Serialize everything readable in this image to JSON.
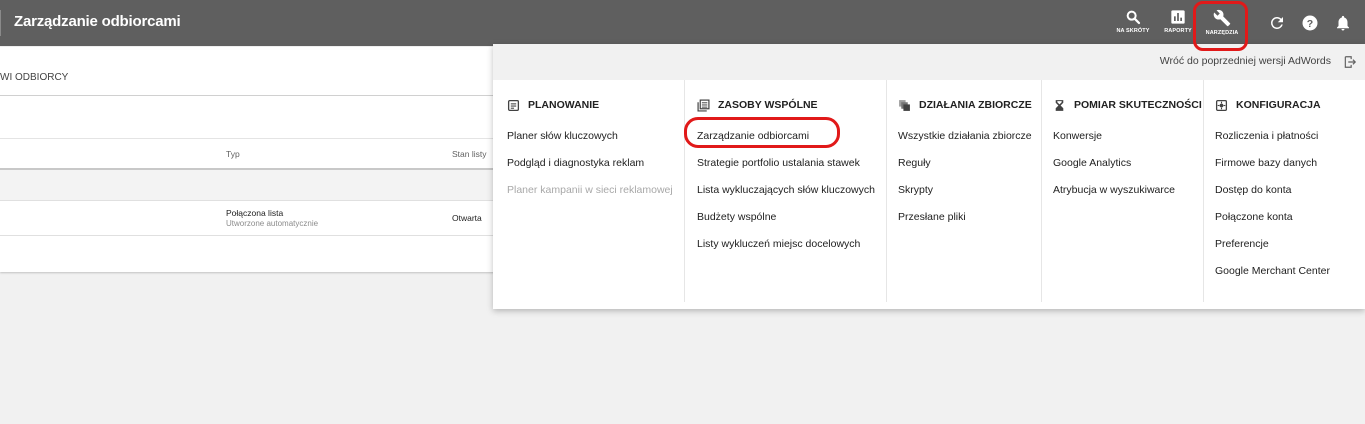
{
  "header": {
    "title": "Zarządzanie odbiorcami",
    "icons": [
      {
        "name": "search-icon",
        "label": "NA SKRÓTY"
      },
      {
        "name": "reports-icon",
        "label": "RAPORTY"
      },
      {
        "name": "wrench-icon",
        "label": "NARZĘDZIA"
      }
    ],
    "extra_icons": [
      "refresh-icon",
      "help-icon",
      "bell-icon"
    ]
  },
  "page": {
    "breadcrumb": "WI ODBIORCY",
    "columns": [
      "Typ",
      "Stan listy"
    ],
    "rows": [
      {
        "type": "Połączona lista",
        "subtype": "Utworzone automatycznie",
        "status": "Otwarta"
      }
    ]
  },
  "tools_menu": {
    "back_link": "Wróć do poprzedniej wersji AdWords",
    "sections": [
      {
        "icon": "planning-icon",
        "title": "PLANOWANIE",
        "items": [
          "Planer słów kluczowych",
          "Podgląd i diagnostyka reklam",
          "Planer kampanii w sieci reklamowej"
        ],
        "disabled": [
          false,
          false,
          true
        ]
      },
      {
        "icon": "shared-library-icon",
        "title": "ZASOBY WSPÓLNE",
        "items": [
          "Zarządzanie odbiorcami",
          "Strategie portfolio ustalania stawek",
          "Lista wykluczających słów kluczowych",
          "Budżety wspólne",
          "Listy wykluczeń miejsc docelowych"
        ]
      },
      {
        "icon": "bulk-actions-icon",
        "title": "DZIAŁANIA ZBIORCZE",
        "items": [
          "Wszystkie działania zbiorcze",
          "Reguły",
          "Skrypty",
          "Przesłane pliki"
        ]
      },
      {
        "icon": "hourglass-icon",
        "title": "POMIAR SKUTECZNOŚCI",
        "items": [
          "Konwersje",
          "Google Analytics",
          "Atrybucja w wyszukiwarce"
        ]
      },
      {
        "icon": "settings-icon",
        "title": "KONFIGURACJA",
        "items": [
          "Rozliczenia i płatności",
          "Firmowe bazy danych",
          "Dostęp do konta",
          "Połączone konta",
          "Preferencje",
          "Google Merchant Center"
        ]
      }
    ]
  },
  "colors": {
    "topbar": "#5f5f5f",
    "annotation": "#e11919"
  }
}
